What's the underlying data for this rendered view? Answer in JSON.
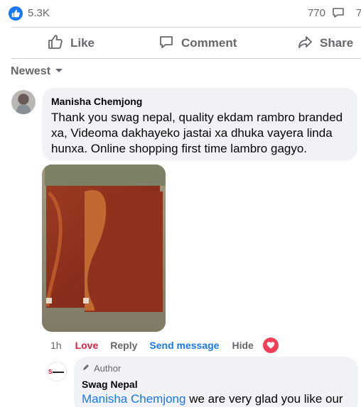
{
  "stats": {
    "like_count": "5.3K",
    "comment_count": "770",
    "share_count": "7"
  },
  "actions": {
    "like_label": "Like",
    "comment_label": "Comment",
    "share_label": "Share"
  },
  "sort": {
    "label": "Newest"
  },
  "comment": {
    "author": "Manisha Chemjong",
    "text": "Thank you swag nepal, quality ekdam rambro branded xa, Videoma dakhayeko jastai xa dhuka vayera linda hunxa. Online shopping first time lambro gagyo.",
    "time": "1h",
    "love_label": "Love",
    "reply_label": "Reply",
    "send_message_label": "Send message",
    "hide_label": "Hide"
  },
  "reply": {
    "badge": "Author",
    "author": "Swag Nepal",
    "mention": "Manisha Chemjong",
    "text": " we are very glad you like our"
  },
  "colors": {
    "accent": "#1877f2",
    "love": "#e41e3f",
    "secondary_text": "#65676b",
    "bubble": "#f0f2f5"
  },
  "icons": [
    "like-reaction-icon",
    "comment-count-icon",
    "like-outline-icon",
    "comment-outline-icon",
    "share-arrow-icon",
    "dropdown-caret-icon",
    "heart-reaction-icon",
    "author-pencil-icon"
  ]
}
